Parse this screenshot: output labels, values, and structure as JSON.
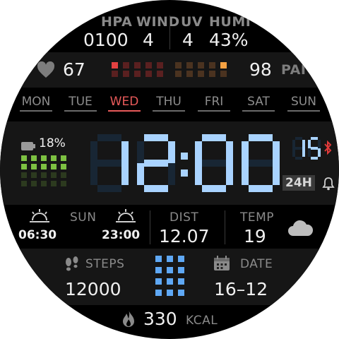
{
  "weather_row": {
    "hpa_label": "HPA",
    "hpa_value": "0100",
    "wind_label": "WIND",
    "wind_value": "4",
    "uv_label": "UV",
    "uv_value": "4",
    "humi_label": "HUMI",
    "humi_value": "43%"
  },
  "health_row": {
    "heart_rate": "67",
    "pai_value": "98",
    "pai_label": "PAI",
    "heart_icon": "heart-icon"
  },
  "weekdays": [
    {
      "label": "MON",
      "active": false
    },
    {
      "label": "TUE",
      "active": false
    },
    {
      "label": "WED",
      "active": true
    },
    {
      "label": "THU",
      "active": false
    },
    {
      "label": "FRI",
      "active": false
    },
    {
      "label": "SAT",
      "active": false
    },
    {
      "label": "SUN",
      "active": false
    }
  ],
  "time": {
    "hours": "12",
    "minutes": "00",
    "seconds": "15",
    "format": "24H",
    "battery": "18%",
    "battery_level": 0.18
  },
  "info_row": {
    "sun_label": "SUN",
    "sunrise": "06:30",
    "sunset": "23:00",
    "dist_label": "DIST",
    "dist_value": "12.07",
    "temp_label": "TEMP",
    "temp_value": "19",
    "weather_icon": "cloud-icon"
  },
  "activity_row": {
    "steps_label": "STEPS",
    "steps_value": "12000",
    "date_label": "DATE",
    "date_value": "16–12"
  },
  "calories": {
    "value": "330",
    "unit": "KCAL"
  },
  "colors": {
    "accent_blue": "#a9d3ff",
    "today_red": "#e85a5a",
    "battery_green": "#7dc142",
    "pai_orange": "#f5a142"
  }
}
